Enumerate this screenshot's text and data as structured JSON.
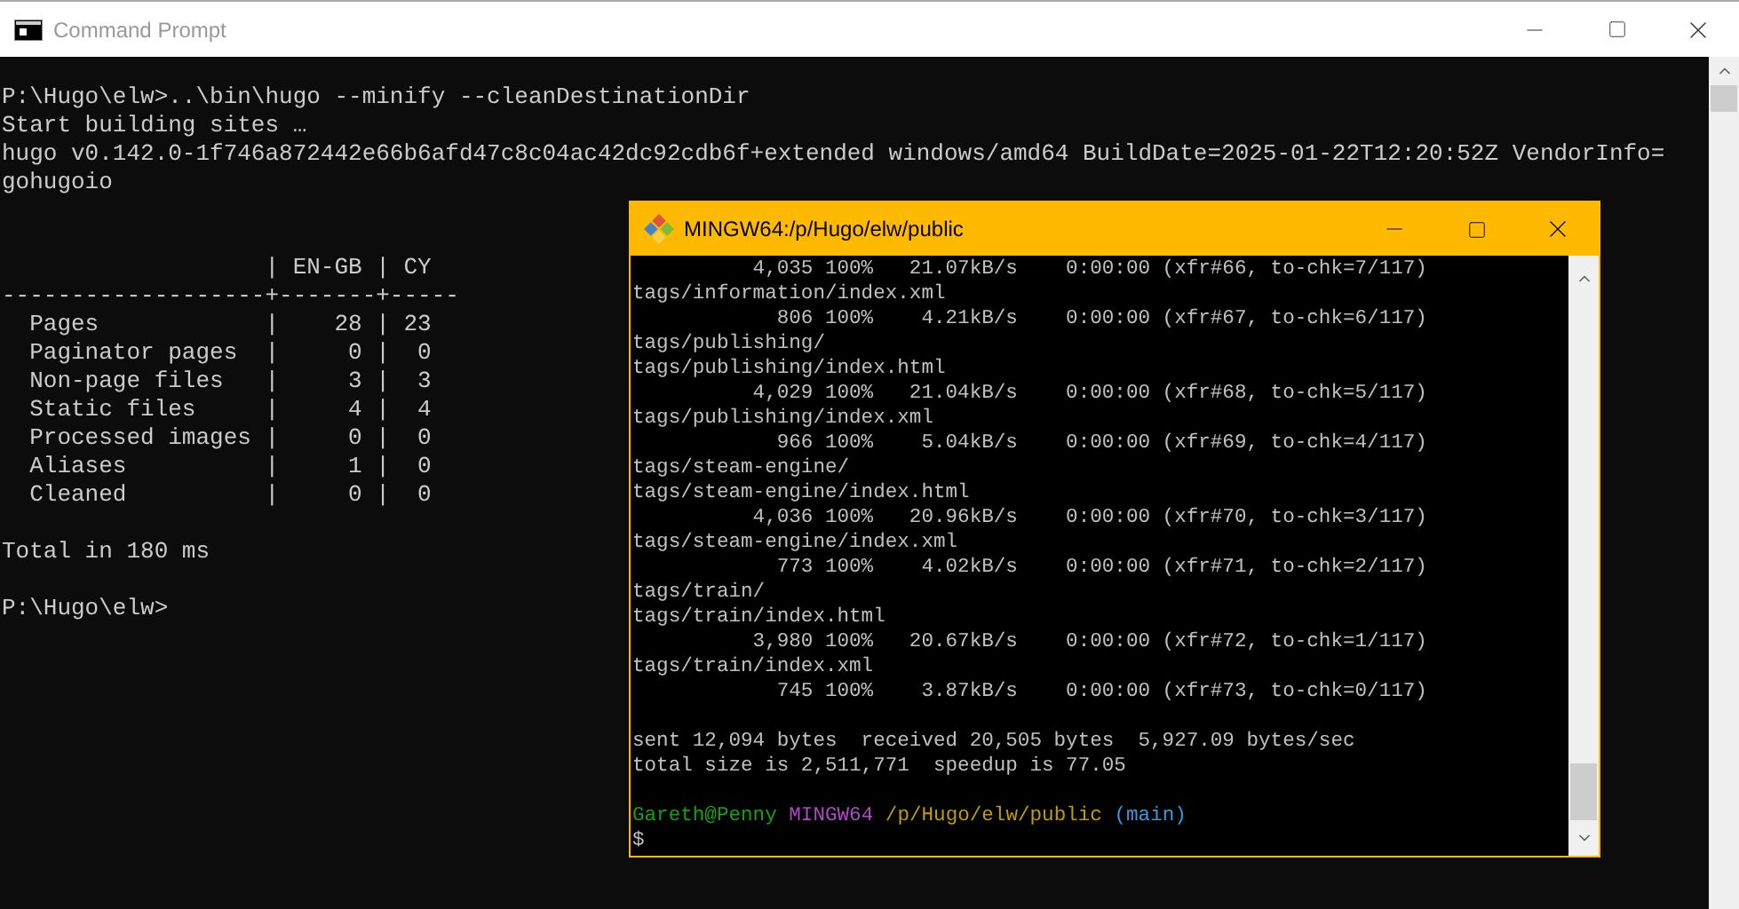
{
  "cmd_window": {
    "title": "Command Prompt",
    "build_output": [
      "P:\\Hugo\\elw>..\\bin\\hugo --minify --cleanDestinationDir",
      "Start building sites …",
      "hugo v0.142.0-1f746a872442e66b6afd47c8c04ac42dc92cdb6f+extended windows/amd64 BuildDate=2025-01-22T12:20:52Z VendorInfo=",
      "gohugoio"
    ],
    "table": [
      "                   | EN-GB | CY",
      "-------------------+-------+-----",
      "  Pages            |    28 | 23",
      "  Paginator pages  |     0 |  0",
      "  Non-page files   |     3 |  3",
      "  Static files     |     4 |  4",
      "  Processed images |     0 |  0",
      "  Aliases          |     1 |  0",
      "  Cleaned          |     0 |  0"
    ],
    "total": "Total in 180 ms",
    "prompt": "P:\\Hugo\\elw>"
  },
  "mingw_window": {
    "title": "MINGW64:/p/Hugo/elw/public",
    "transfer_log": [
      "          4,035 100%   21.07kB/s    0:00:00 (xfr#66, to-chk=7/117)",
      "tags/information/index.xml",
      "            806 100%    4.21kB/s    0:00:00 (xfr#67, to-chk=6/117)",
      "tags/publishing/",
      "tags/publishing/index.html",
      "          4,029 100%   21.04kB/s    0:00:00 (xfr#68, to-chk=5/117)",
      "tags/publishing/index.xml",
      "            966 100%    5.04kB/s    0:00:00 (xfr#69, to-chk=4/117)",
      "tags/steam-engine/",
      "tags/steam-engine/index.html",
      "          4,036 100%   20.96kB/s    0:00:00 (xfr#70, to-chk=3/117)",
      "tags/steam-engine/index.xml",
      "            773 100%    4.02kB/s    0:00:00 (xfr#71, to-chk=2/117)",
      "tags/train/",
      "tags/train/index.html",
      "          3,980 100%   20.67kB/s    0:00:00 (xfr#72, to-chk=1/117)",
      "tags/train/index.xml",
      "            745 100%    3.87kB/s    0:00:00 (xfr#73, to-chk=0/117)"
    ],
    "summary": [
      "sent 12,094 bytes  received 20,505 bytes  5,927.09 bytes/sec",
      "total size is 2,511,771  speedup is 77.05"
    ],
    "prompt": [
      {
        "text": "Gareth@Penny",
        "color": "#13a10e"
      },
      {
        "text": "MINGW64",
        "color": "#b148c6"
      },
      {
        "text": "/p/Hugo/elw/public",
        "color": "#c19c00"
      },
      {
        "text": "(main)",
        "color": "#3a96dd"
      }
    ],
    "cursor_line": "$"
  }
}
